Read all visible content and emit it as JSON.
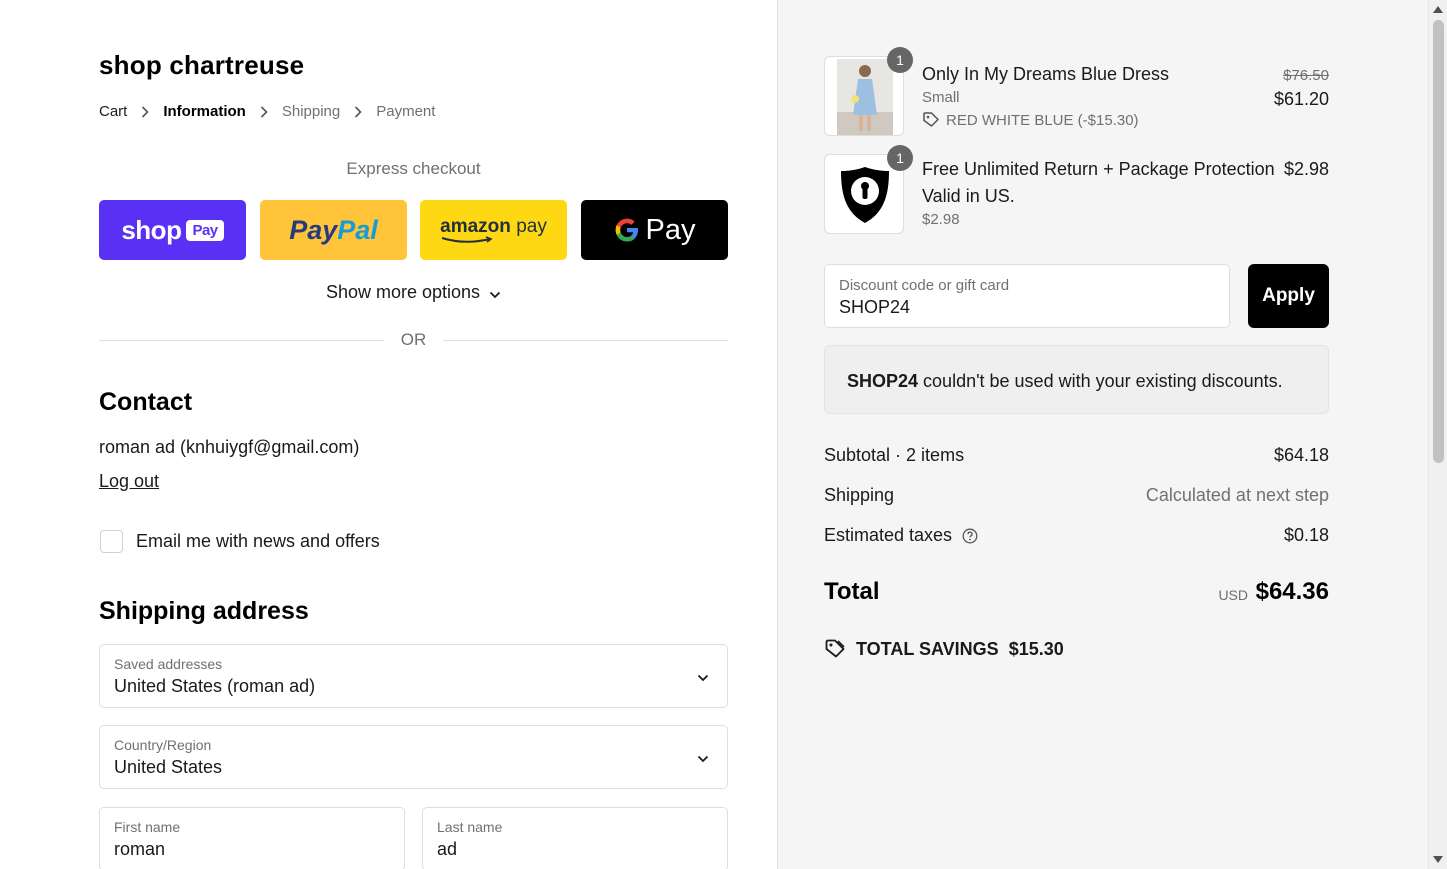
{
  "store": {
    "name": "shop chartreuse"
  },
  "breadcrumb": {
    "items": [
      {
        "label": "Cart"
      },
      {
        "label": "Information"
      },
      {
        "label": "Shipping"
      },
      {
        "label": "Payment"
      }
    ],
    "active": "Information"
  },
  "express": {
    "title": "Express checkout",
    "buttons": [
      {
        "name": "Shop Pay",
        "text_main": "shop",
        "text_badge": "Pay",
        "color": "#5a31f4"
      },
      {
        "name": "PayPal",
        "text_a": "Pay",
        "text_b": "Pal",
        "color": "#ffc439"
      },
      {
        "name": "Amazon Pay",
        "text_main": "amazon",
        "text_sub": "pay",
        "color": "#ffd814"
      },
      {
        "name": "Google Pay",
        "text": "Pay",
        "color": "#000000"
      }
    ],
    "show_more": "Show more options",
    "or": "OR"
  },
  "contact": {
    "title": "Contact",
    "user": "roman ad (knhuiygf@gmail.com)",
    "logout": "Log out",
    "newsletter_label": "Email me with news and offers",
    "newsletter_checked": false
  },
  "shipping": {
    "title": "Shipping address",
    "saved_addresses": {
      "label": "Saved addresses",
      "value": "United States (roman ad)"
    },
    "country": {
      "label": "Country/Region",
      "value": "United States"
    },
    "first_name": {
      "label": "First name",
      "value": "roman"
    },
    "last_name": {
      "label": "Last name",
      "value": "ad"
    }
  },
  "order": {
    "items": [
      {
        "title": "Only In My Dreams Blue Dress",
        "variant": "Small",
        "discount": "RED WHITE BLUE (-$15.30)",
        "price_original": "$76.50",
        "price": "$61.20",
        "qty": "1"
      },
      {
        "title_line1": "Free Unlimited Return + Package Protection",
        "title_line2": "Valid in US.",
        "variant": "$2.98",
        "price": "$2.98",
        "qty": "1"
      }
    ],
    "discount_field": {
      "label": "Discount code or gift card",
      "value": "SHOP24"
    },
    "apply": "Apply",
    "notice": {
      "code": "SHOP24",
      "message": " couldn't be used with your existing discounts."
    },
    "summary": {
      "subtotal_label": "Subtotal · 2 items",
      "subtotal_value": "$64.18",
      "shipping_label": "Shipping",
      "shipping_value": "Calculated at next step",
      "taxes_label": "Estimated taxes",
      "taxes_value": "$0.18"
    },
    "total": {
      "label": "Total",
      "currency": "USD",
      "value": "$64.36"
    },
    "savings": {
      "label": "TOTAL SAVINGS",
      "value": "$15.30"
    }
  },
  "colors": {
    "accent": "#000000",
    "muted": "#707070",
    "sidebar_bg": "#f5f5f5"
  }
}
